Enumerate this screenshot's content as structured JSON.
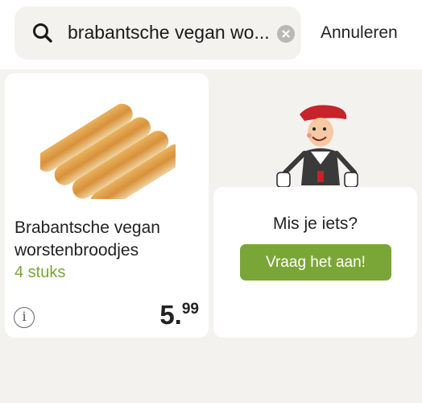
{
  "search": {
    "query": "brabantsche vegan wo...",
    "cancel_label": "Annuleren"
  },
  "product": {
    "title": "Brabantsche vegan worstenbroodjes",
    "unit": "4 stuks",
    "price_whole": "5.",
    "price_cents": "99"
  },
  "ask": {
    "question": "Mis je iets?",
    "button_label": "Vraag het aan!"
  },
  "colors": {
    "accent_green": "#7aa637",
    "background": "#f3f2ef",
    "card": "#ffffff"
  },
  "icons": [
    "search-icon",
    "clear-icon",
    "info-icon"
  ]
}
